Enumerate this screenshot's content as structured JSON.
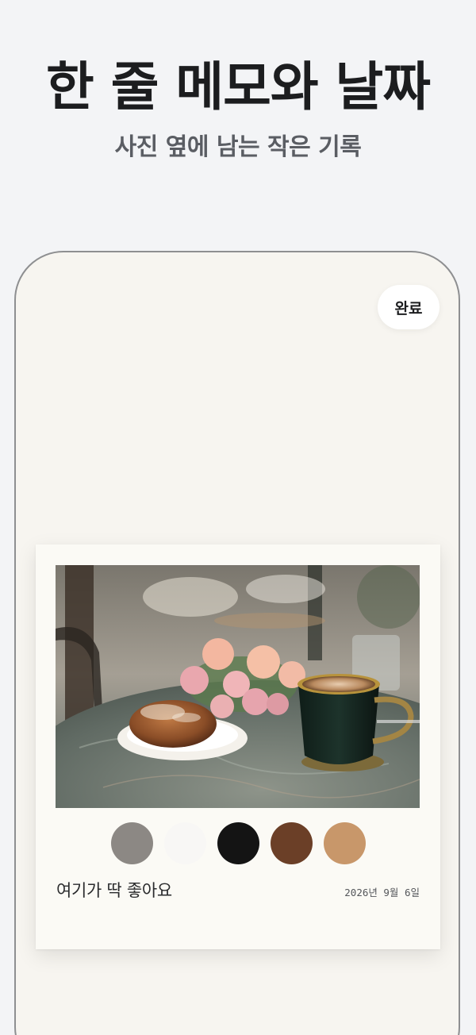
{
  "header": {
    "title": "한 줄 메모와 날짜",
    "subtitle": "사진 옆에 남는 작은 기록"
  },
  "toolbar": {
    "done_label": "완료"
  },
  "card": {
    "photo_icon": "cafe-photo",
    "swatches": [
      {
        "color": "#8c8884",
        "name": "gray"
      },
      {
        "color": "#f8f7f5",
        "name": "white"
      },
      {
        "color": "#141414",
        "name": "black"
      },
      {
        "color": "#6b3f27",
        "name": "brown"
      },
      {
        "color": "#c8976a",
        "name": "tan"
      }
    ],
    "memo": "여기가 딱 좋아요",
    "date": "2026년 9월 6일"
  }
}
